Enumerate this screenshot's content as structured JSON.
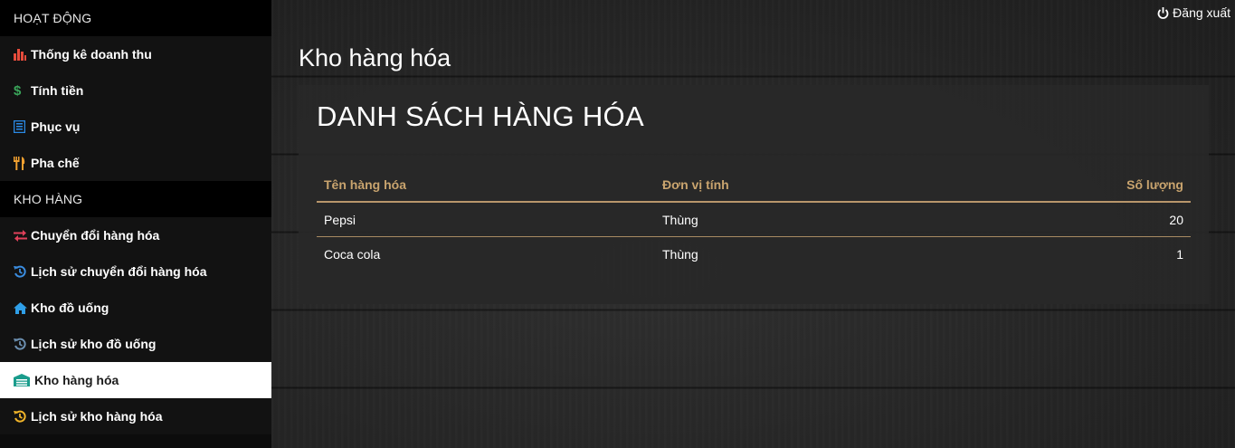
{
  "sidebar": {
    "sections": [
      {
        "header": "HOẠT ĐỘNG",
        "items": [
          {
            "label": "Thống kê doanh thu",
            "icon": "bar-chart-icon",
            "color": "#e74c3c"
          },
          {
            "label": "Tính tiền",
            "icon": "dollar-icon",
            "color": "#3aa55a"
          },
          {
            "label": "Phục vụ",
            "icon": "list-icon",
            "color": "#2a8ae6"
          },
          {
            "label": "Pha chế",
            "icon": "cutlery-icon",
            "color": "#f0a030"
          }
        ]
      },
      {
        "header": "KHO HÀNG",
        "items": [
          {
            "label": "Chuyển đổi hàng hóa",
            "icon": "exchange-icon",
            "color": "#e0405a"
          },
          {
            "label": "Lịch sử chuyển đổi hàng hóa",
            "icon": "history-icon",
            "color": "#3b8de0"
          },
          {
            "label": "Kho đồ uống",
            "icon": "home-icon",
            "color": "#2f9fe8"
          },
          {
            "label": "Lịch sử kho đồ uống",
            "icon": "history-icon",
            "color": "#6c8fb0"
          },
          {
            "label": "Kho hàng hóa",
            "icon": "warehouse-icon",
            "color": "#1a9c8c",
            "active": true
          },
          {
            "label": "Lịch sử kho hàng hóa",
            "icon": "history-icon",
            "color": "#f0b429"
          }
        ]
      }
    ]
  },
  "header": {
    "logout_label": "Đăng xuất",
    "logout_icon": "power-icon"
  },
  "main": {
    "page_title": "Kho hàng hóa",
    "panel_title": "DANH SÁCH HÀNG HÓA",
    "table": {
      "columns": [
        "Tên hàng hóa",
        "Đơn vị tính",
        "Số lượng"
      ],
      "rows": [
        [
          "Pepsi",
          "Thùng",
          "20"
        ],
        [
          "Coca cola",
          "Thùng",
          "1"
        ]
      ]
    }
  },
  "colors": {
    "header_gold": "#c9a46e",
    "sidebar_bg": "#121212",
    "active_bg": "#ffffff"
  }
}
